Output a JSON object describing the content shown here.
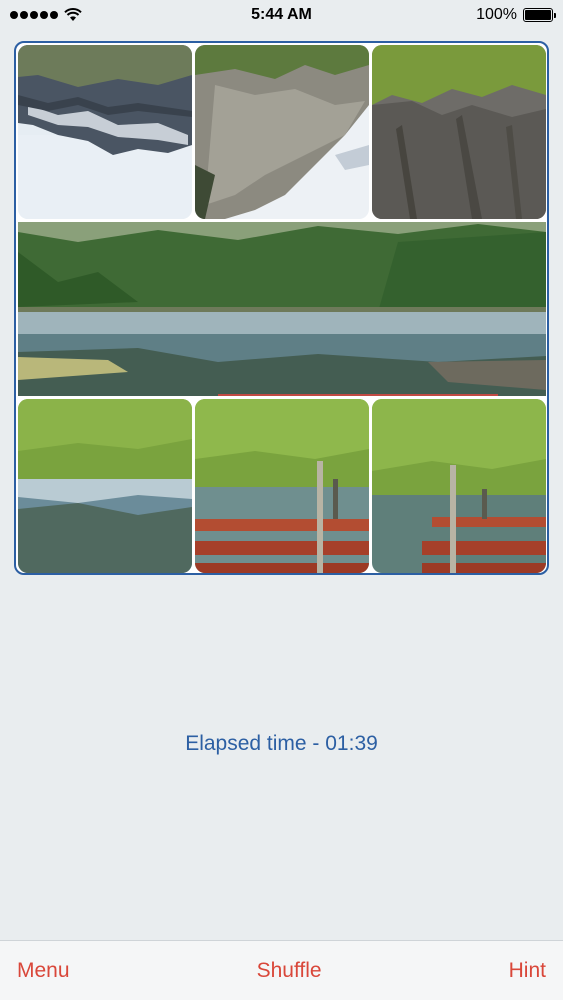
{
  "status": {
    "time": "5:44 AM",
    "battery": "100%",
    "battery_level": 1.0
  },
  "board": {
    "tiles": [
      {
        "name": "puzzle-tile-1",
        "scene": "mountain-upside-down"
      },
      {
        "name": "puzzle-tile-2",
        "scene": "cliff-upside-down"
      },
      {
        "name": "puzzle-tile-3",
        "scene": "rock-cliff"
      },
      {
        "name": "puzzle-tile-4",
        "scene": "lake-forest-panorama"
      },
      {
        "name": "puzzle-tile-5",
        "scene": "grass-water-upside-down"
      },
      {
        "name": "puzzle-tile-6",
        "scene": "grass-bench-upside-down"
      },
      {
        "name": "puzzle-tile-7",
        "scene": "grass-bench-upside-down"
      }
    ],
    "border_color": "#2c5fa3"
  },
  "elapsed": {
    "text": "Elapsed time - 01:39"
  },
  "tabbar": {
    "menu_label": "Menu",
    "shuffle_label": "Shuffle",
    "hint_label": "Hint",
    "accent_color": "#d9473a"
  }
}
